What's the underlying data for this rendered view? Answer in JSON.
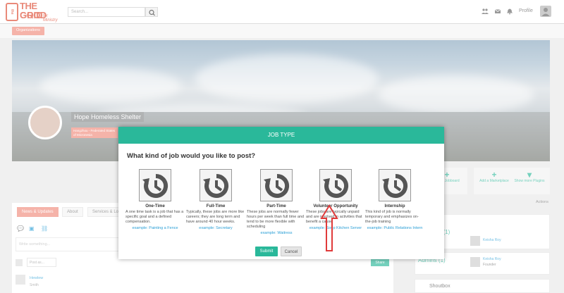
{
  "brand": {
    "line1": "THE GOOD",
    "line2": "GRID",
    "tagline": "for Ministry",
    "badge": "the"
  },
  "search": {
    "placeholder": "Search..."
  },
  "nav": {
    "profile_label": "Profile"
  },
  "subnav": {
    "organizations_label": "Organizations"
  },
  "org": {
    "name": "Hope Homeless Shelter",
    "tag": "Hangzhou - Federated States of Micronesia"
  },
  "actions": [
    {
      "label": "Add a Jobboard"
    },
    {
      "label": "Add a Marketplace"
    },
    {
      "label": "Show more Plugins"
    }
  ],
  "tabs": [
    {
      "label": "News & Updates"
    },
    {
      "label": "About"
    },
    {
      "label": "Services & Lo..."
    }
  ],
  "post": {
    "placeholder": "Write something...",
    "post_to": "Post as...",
    "share_label": "Share"
  },
  "feed": {
    "author": "Hewlew",
    "role": "Smith"
  },
  "right": {
    "actions_label": "Actions",
    "members_title": "Members (1)",
    "member1": {
      "name": "Keisha Roy",
      "role": "Founder"
    },
    "admins_title": "Admins (1)",
    "member2": {
      "name": "Keisha Roy",
      "role": "Founder"
    },
    "shoutbox": "Shoutbox"
  },
  "modal": {
    "title": "JOB TYPE",
    "question": "What kind of job would you like to post?",
    "options": [
      {
        "title": "One-Time",
        "desc": "A one time task is a job that has a specific goal and a defined compensation.",
        "example": "example: Painting a Fence"
      },
      {
        "title": "Full-Time",
        "desc": "Typically, these jobs are more like careers; they are long term and have around 40 hour weeks.",
        "example": "example: Secretary"
      },
      {
        "title": "Part-Time",
        "desc": "These jobs are normally fewer hours per week than full time and tend to be more flexible with scheduling",
        "example": "example: Waitress"
      },
      {
        "title": "Volunteer Opportunity",
        "desc": "These jobs are typically unpaid and are involved in activities that benefit a cause",
        "example": "example: Soup Kitchen Server"
      },
      {
        "title": "Internship",
        "desc": "This kind of job is normally temporary and emphasizes on-the-job training",
        "example": "example: Public Relations Intern"
      }
    ],
    "submit_label": "Submit",
    "cancel_label": "Cancel"
  },
  "colors": {
    "accent": "#2ab89a",
    "brand": "#f08a7c",
    "link": "#2a9fd6",
    "arrow": "#e03a3a"
  }
}
